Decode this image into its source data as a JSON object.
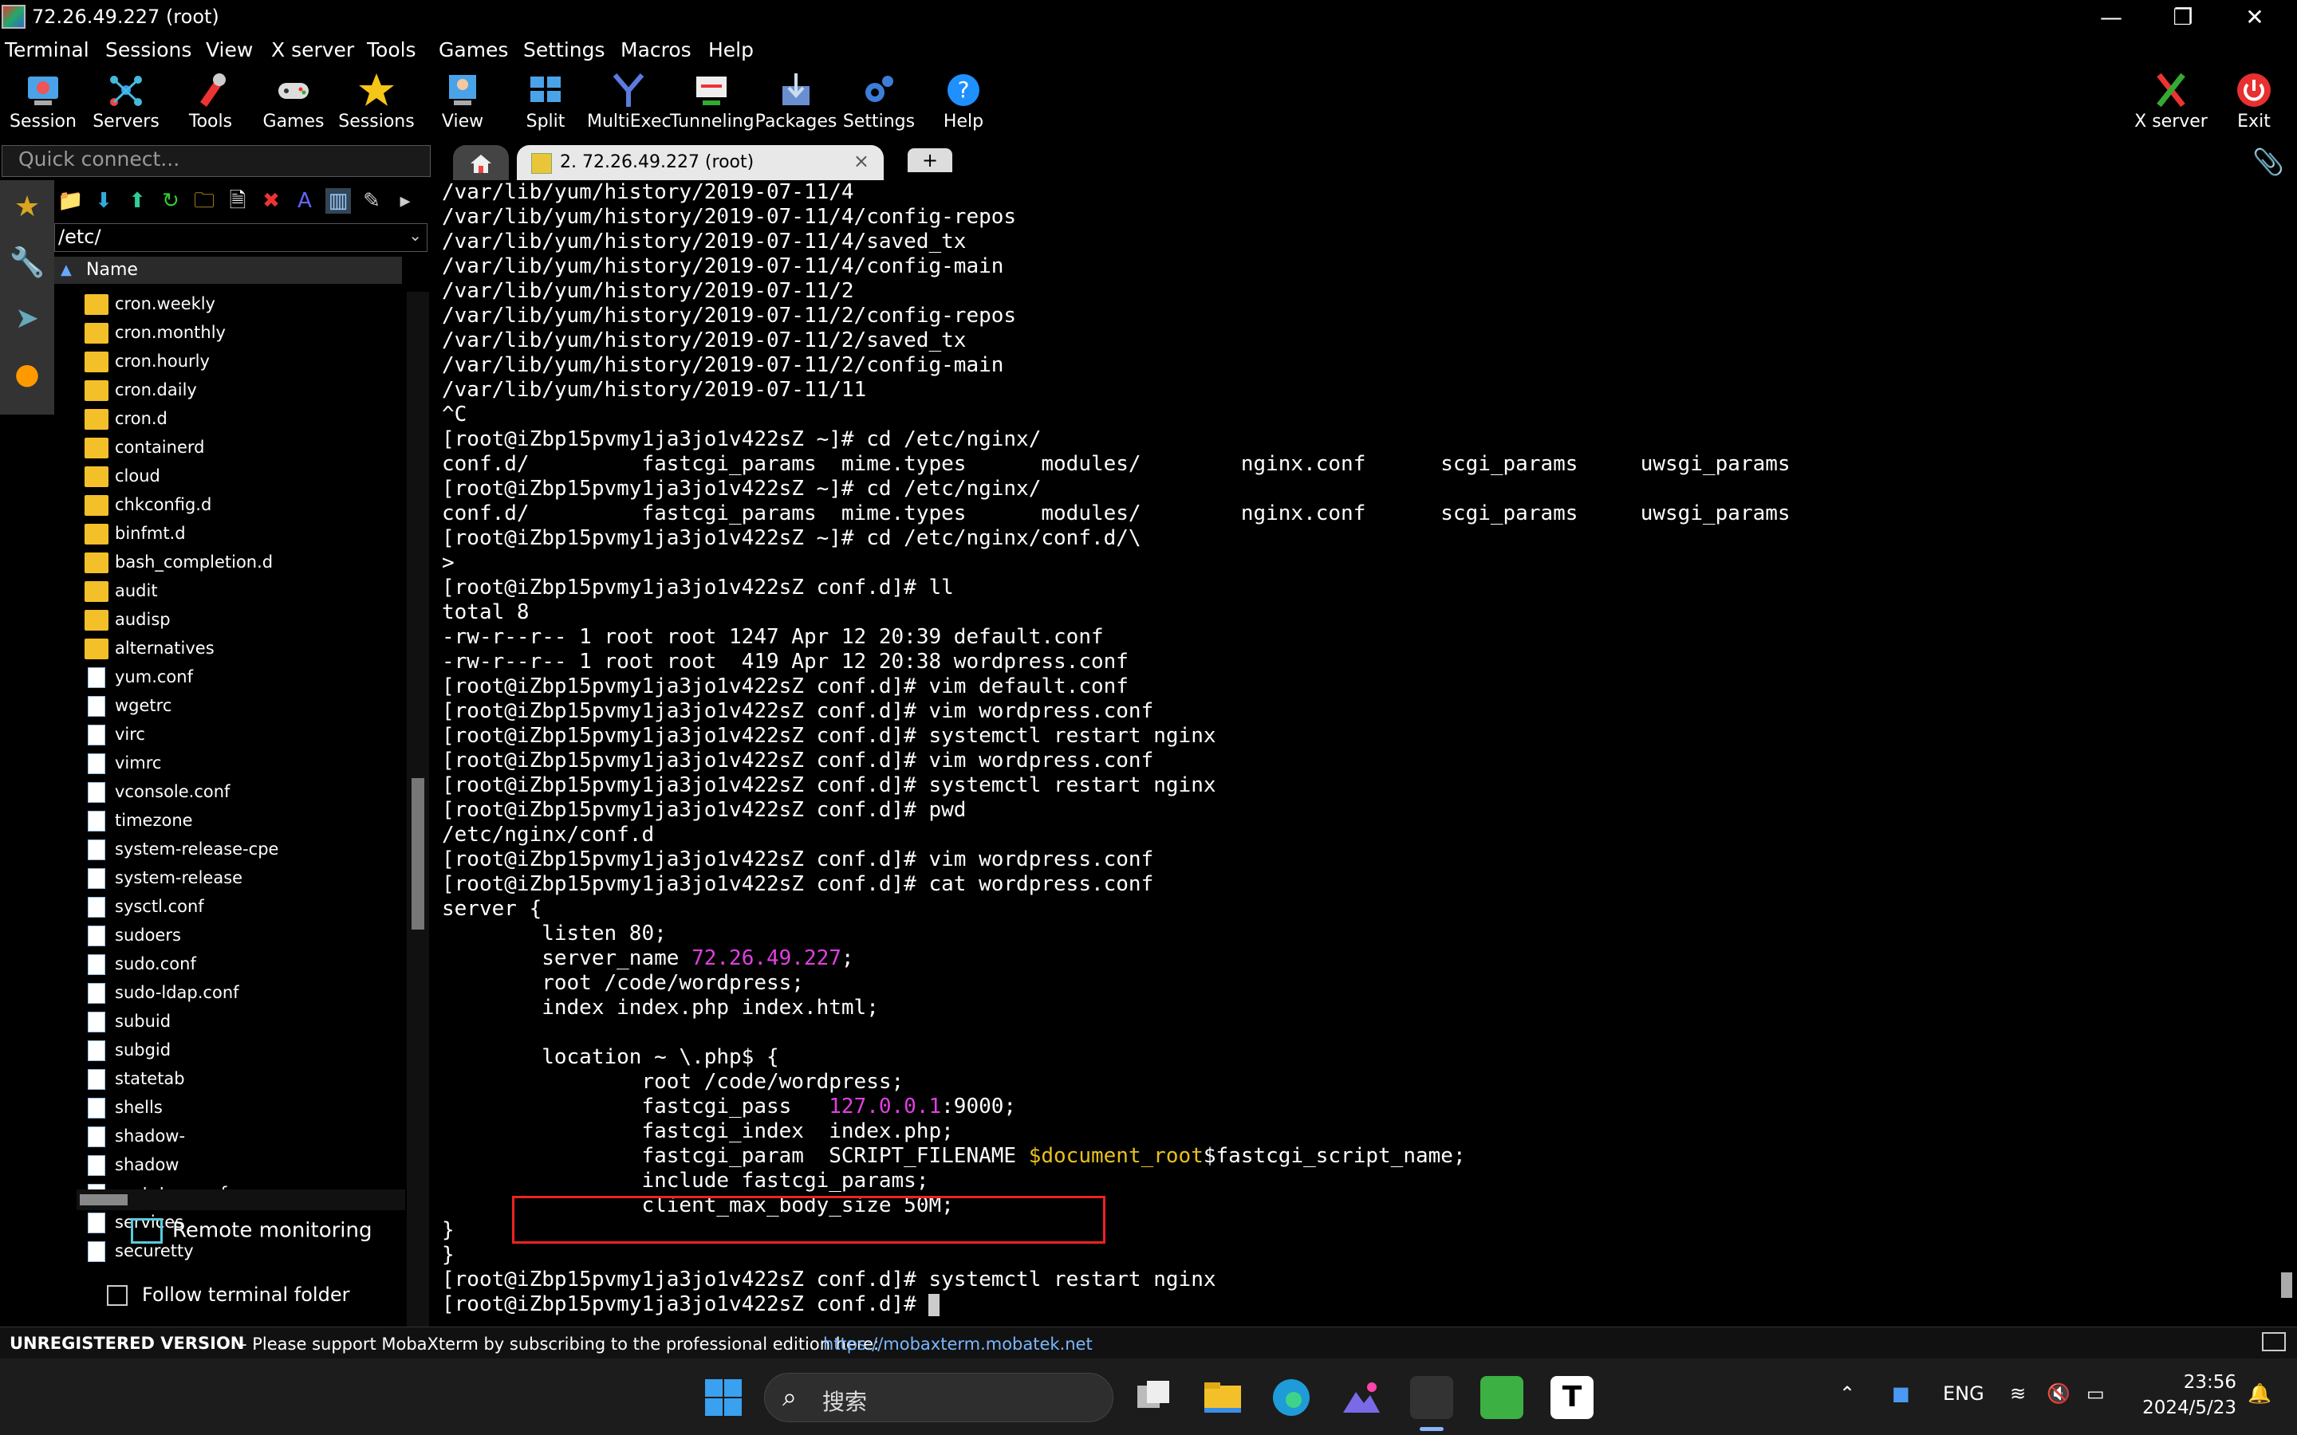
{
  "window": {
    "title": "72.26.49.227 (root)"
  },
  "menu": [
    "Terminal",
    "Sessions",
    "View",
    "X server",
    "Tools",
    "Games",
    "Settings",
    "Macros",
    "Help"
  ],
  "toolbar": {
    "items": [
      "Session",
      "Servers",
      "Tools",
      "Games",
      "Sessions",
      "View",
      "Split",
      "MultiExec",
      "Tunneling",
      "Packages",
      "Settings",
      "Help"
    ],
    "right": [
      "X server",
      "Exit"
    ]
  },
  "quick_connect": {
    "placeholder": "Quick connect..."
  },
  "tabs": {
    "session": "2. 72.26.49.227 (root)",
    "close": "×",
    "new": "+"
  },
  "sftp": {
    "path": "/etc/",
    "column": "Name",
    "files": [
      {
        "name": "cron.weekly",
        "type": "folder"
      },
      {
        "name": "cron.monthly",
        "type": "folder"
      },
      {
        "name": "cron.hourly",
        "type": "folder"
      },
      {
        "name": "cron.daily",
        "type": "folder"
      },
      {
        "name": "cron.d",
        "type": "folder"
      },
      {
        "name": "containerd",
        "type": "folder"
      },
      {
        "name": "cloud",
        "type": "folder"
      },
      {
        "name": "chkconfig.d",
        "type": "folder"
      },
      {
        "name": "binfmt.d",
        "type": "folder"
      },
      {
        "name": "bash_completion.d",
        "type": "folder"
      },
      {
        "name": "audit",
        "type": "folder"
      },
      {
        "name": "audisp",
        "type": "folder"
      },
      {
        "name": "alternatives",
        "type": "folder"
      },
      {
        "name": "yum.conf",
        "type": "link"
      },
      {
        "name": "wgetrc",
        "type": "file"
      },
      {
        "name": "virc",
        "type": "file"
      },
      {
        "name": "vimrc",
        "type": "file"
      },
      {
        "name": "vconsole.conf",
        "type": "file"
      },
      {
        "name": "timezone",
        "type": "file"
      },
      {
        "name": "system-release-cpe",
        "type": "file"
      },
      {
        "name": "system-release",
        "type": "link"
      },
      {
        "name": "sysctl.conf",
        "type": "link"
      },
      {
        "name": "sudoers",
        "type": "file"
      },
      {
        "name": "sudo.conf",
        "type": "file"
      },
      {
        "name": "sudo-ldap.conf",
        "type": "file"
      },
      {
        "name": "subuid",
        "type": "file"
      },
      {
        "name": "subgid",
        "type": "file"
      },
      {
        "name": "statetab",
        "type": "file"
      },
      {
        "name": "shells",
        "type": "file"
      },
      {
        "name": "shadow-",
        "type": "file"
      },
      {
        "name": "shadow",
        "type": "file"
      },
      {
        "name": "sestatus.conf",
        "type": "file"
      },
      {
        "name": "services",
        "type": "file"
      },
      {
        "name": "securetty",
        "type": "file"
      }
    ],
    "remote_monitoring": "Remote monitoring",
    "follow_folder": "Follow terminal folder"
  },
  "terminal": {
    "lines": [
      [
        {
          "t": "/var/lib/yum/history/2019-07-11/4"
        }
      ],
      [
        {
          "t": "/var/lib/yum/history/2019-07-11/4/config-repos"
        }
      ],
      [
        {
          "t": "/var/lib/yum/history/2019-07-11/4/saved_tx"
        }
      ],
      [
        {
          "t": "/var/lib/yum/history/2019-07-11/4/config-main"
        }
      ],
      [
        {
          "t": "/var/lib/yum/history/2019-07-11/2"
        }
      ],
      [
        {
          "t": "/var/lib/yum/history/2019-07-11/2/config-repos"
        }
      ],
      [
        {
          "t": "/var/lib/yum/history/2019-07-11/2/saved_tx"
        }
      ],
      [
        {
          "t": "/var/lib/yum/history/2019-07-11/2/config-main"
        }
      ],
      [
        {
          "t": "/var/lib/yum/history/2019-07-11/11"
        }
      ],
      [
        {
          "t": "^C"
        }
      ],
      [
        {
          "t": "[root@iZbp15pvmy1ja3jo1v422sZ ~]# cd /etc/nginx/"
        }
      ],
      [
        {
          "t": "conf.d/         fastcgi_params  mime.types      modules/        nginx.conf      scgi_params     uwsgi_params"
        }
      ],
      [
        {
          "t": "[root@iZbp15pvmy1ja3jo1v422sZ ~]# cd /etc/nginx/"
        }
      ],
      [
        {
          "t": "conf.d/         fastcgi_params  mime.types      modules/        nginx.conf      scgi_params     uwsgi_params"
        }
      ],
      [
        {
          "t": "[root@iZbp15pvmy1ja3jo1v422sZ ~]# cd /etc/nginx/conf.d/\\"
        }
      ],
      [
        {
          "t": ">"
        }
      ],
      [
        {
          "t": "[root@iZbp15pvmy1ja3jo1v422sZ conf.d]# ll"
        }
      ],
      [
        {
          "t": "total 8"
        }
      ],
      [
        {
          "t": "-rw-r--r-- 1 root root 1247 Apr 12 20:39 default.conf"
        }
      ],
      [
        {
          "t": "-rw-r--r-- 1 root root  419 Apr 12 20:38 wordpress.conf"
        }
      ],
      [
        {
          "t": "[root@iZbp15pvmy1ja3jo1v422sZ conf.d]# vim default.conf"
        }
      ],
      [
        {
          "t": "[root@iZbp15pvmy1ja3jo1v422sZ conf.d]# vim wordpress.conf"
        }
      ],
      [
        {
          "t": "[root@iZbp15pvmy1ja3jo1v422sZ conf.d]# systemctl restart nginx"
        }
      ],
      [
        {
          "t": "[root@iZbp15pvmy1ja3jo1v422sZ conf.d]# vim wordpress.conf"
        }
      ],
      [
        {
          "t": "[root@iZbp15pvmy1ja3jo1v422sZ conf.d]# systemctl restart nginx"
        }
      ],
      [
        {
          "t": "[root@iZbp15pvmy1ja3jo1v422sZ conf.d]# pwd"
        }
      ],
      [
        {
          "t": "/etc/nginx/conf.d"
        }
      ],
      [
        {
          "t": "[root@iZbp15pvmy1ja3jo1v422sZ conf.d]# vim wordpress.conf"
        }
      ],
      [
        {
          "t": "[root@iZbp15pvmy1ja3jo1v422sZ conf.d]# cat wordpress.conf"
        }
      ],
      [
        {
          "t": "server {"
        }
      ],
      [
        {
          "t": "        listen 80;"
        }
      ],
      [
        {
          "t": "        server_name "
        },
        {
          "t": "72.26.49.227",
          "c": "mag"
        },
        {
          "t": ";"
        }
      ],
      [
        {
          "t": "        root /code/wordpress;"
        }
      ],
      [
        {
          "t": "        index index.php index.html;"
        }
      ],
      [
        {
          "t": ""
        }
      ],
      [
        {
          "t": "        location ~ \\.php$ {"
        }
      ],
      [
        {
          "t": "                root /code/wordpress;"
        }
      ],
      [
        {
          "t": "                fastcgi_pass   "
        },
        {
          "t": "127.0.0.1",
          "c": "mag"
        },
        {
          "t": ":9000;"
        }
      ],
      [
        {
          "t": "                fastcgi_index  index.php;"
        }
      ],
      [
        {
          "t": "                fastcgi_param  SCRIPT_FILENAME "
        },
        {
          "t": "$document_root",
          "c": "ylw"
        },
        {
          "t": "$fastcgi_script_name;"
        }
      ],
      [
        {
          "t": "                include fastcgi_params;"
        }
      ],
      [
        {
          "t": "                client_max_body_size 50M;"
        }
      ],
      [
        {
          "t": "}"
        }
      ],
      [
        {
          "t": "}"
        }
      ],
      [
        {
          "t": "[root@iZbp15pvmy1ja3jo1v422sZ conf.d]# systemctl restart nginx"
        }
      ],
      [
        {
          "t": "[root@iZbp15pvmy1ja3jo1v422sZ conf.d]# "
        }
      ]
    ]
  },
  "status": {
    "unregistered": "UNREGISTERED VERSION",
    "message": "-  Please support MobaXterm by subscribing to the professional edition here:",
    "link": "https://mobaxterm.mobatek.net"
  },
  "taskbar": {
    "search": "搜索",
    "lang": "ENG",
    "time": "23:56",
    "date": "2024/5/23"
  },
  "colors": {
    "terminal_bg": "#000000",
    "highlight_box": "#e22222",
    "magenta": "#e040e0",
    "yellow": "#e8c020"
  }
}
